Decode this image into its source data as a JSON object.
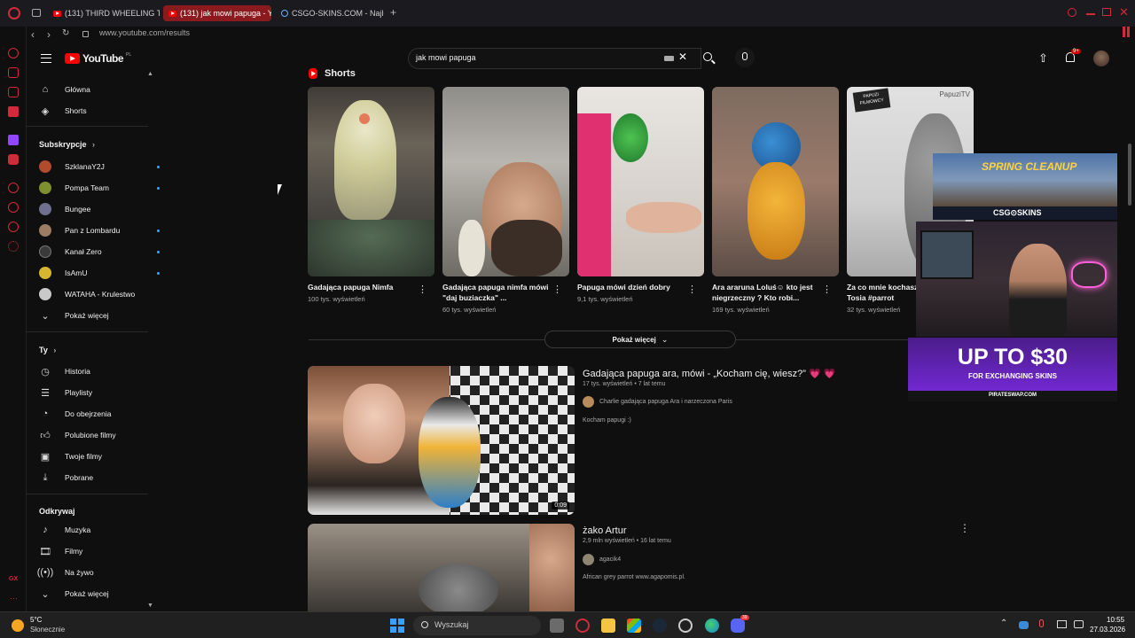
{
  "browser": {
    "tabs": [
      {
        "label": "(131) THIRD WHEELING TH"
      },
      {
        "label": "(131) jak mowi papuga - Yo"
      },
      {
        "label": "CSGO-SKINS.COM - Najle"
      }
    ],
    "new_tab": "+",
    "url": "www.youtube.com/results"
  },
  "youtube": {
    "logo": "YouTube",
    "region": "PL",
    "search_value": "jak mowi papuga",
    "notification_count": "9+",
    "guide": {
      "main": [
        {
          "label": "Główna",
          "icon": "home-icon"
        },
        {
          "label": "Shorts",
          "icon": "shorts-icon"
        }
      ],
      "subscriptions_title": "Subskrypcje",
      "subscriptions": [
        {
          "label": "SzklanaY2J",
          "color": "#b24a2e",
          "dot": true
        },
        {
          "label": "Pompa Team",
          "color": "#7e8f2d",
          "dot": true
        },
        {
          "label": "Bungee",
          "color": "#6f6f8f",
          "dot": false
        },
        {
          "label": "Pan z Lombardu",
          "color": "#9a7d63",
          "dot": true
        },
        {
          "label": "Kanał Zero",
          "color": "#3a3a3a",
          "dot": true
        },
        {
          "label": "IsAmU",
          "color": "#d8b52e",
          "dot": true
        },
        {
          "label": "WATAHA - Krulestwo",
          "color": "#c9c9c9",
          "dot": false
        }
      ],
      "show_more": "Pokaż więcej",
      "you_title": "Ty",
      "you": [
        {
          "label": "Historia",
          "icon": "history-icon"
        },
        {
          "label": "Playlisty",
          "icon": "playlist-icon"
        },
        {
          "label": "Do obejrzenia",
          "icon": "watch-later-icon"
        },
        {
          "label": "Polubione filmy",
          "icon": "like-icon"
        },
        {
          "label": "Twoje filmy",
          "icon": "your-videos-icon"
        },
        {
          "label": "Pobrane",
          "icon": "download-icon"
        }
      ],
      "explore_title": "Odkrywaj",
      "explore": [
        {
          "label": "Muzyka",
          "icon": "music-icon"
        },
        {
          "label": "Filmy",
          "icon": "movies-icon"
        },
        {
          "label": "Na żywo",
          "icon": "live-icon"
        }
      ],
      "show_more_2": "Pokaż więcej"
    },
    "shorts_title": "Shorts",
    "shorts": [
      {
        "title": "Gadająca papuga Nimfa",
        "views": "100 tys. wyświetleń"
      },
      {
        "title": "Gadająca papuga nimfa mówi \"daj buziaczka\" ...",
        "views": "60 tys. wyświetleń"
      },
      {
        "title": "Papuga mówi dzień dobry",
        "views": "9,1 tys. wyświetleń"
      },
      {
        "title": "Ara araruna Loluś☺ kto jest niegrzeczny ? Kto robi...",
        "views": "169 tys. wyświetleń"
      },
      {
        "title": "Za co mnie kochasz żako Tosia  #parrot",
        "views": "32 tys. wyświetleń"
      }
    ],
    "shorts_overlay": {
      "line1": "PAPUZI",
      "line2": "FILMOWCY",
      "channel": "PapuziTV"
    },
    "show_more_shorts": "Pokaż więcej",
    "videos": [
      {
        "title": "Gadająca papuga ara, mówi - „Kocham cię, wiesz?” 💗 💗",
        "meta": "17 tys. wyświetleń • 7 lat temu",
        "channel": "Charlie gadająca papuga Ara i narzeczona Paris",
        "desc": "Kocham papugi :)",
        "duration": "0:09"
      },
      {
        "title": "żako Artur",
        "meta": "2,9 mln wyświetleń • 16 lat temu",
        "channel": "agacik4",
        "desc": "African grey parrot www.agapomis.pl."
      }
    ]
  },
  "overlay": {
    "top_banner": "SPRING CLEANUP",
    "brand": "CSG⊙SKINS",
    "ad_line1": "UP TO $30",
    "ad_line2": "FOR EXCHANGING SKINS",
    "ad_url": "PIRATESWAP.COM"
  },
  "taskbar": {
    "weather_temp": "5°C",
    "weather_desc": "Słonecznie",
    "search_placeholder": "Wyszukaj",
    "time": "10:55",
    "date": "27.03.2026",
    "discord_badge": "39"
  },
  "colors": {
    "accent": "#ff0000",
    "opera_red": "#d12b3b",
    "active_tab": "#8b1a1f",
    "ad_purple": "#7a2ae0"
  }
}
